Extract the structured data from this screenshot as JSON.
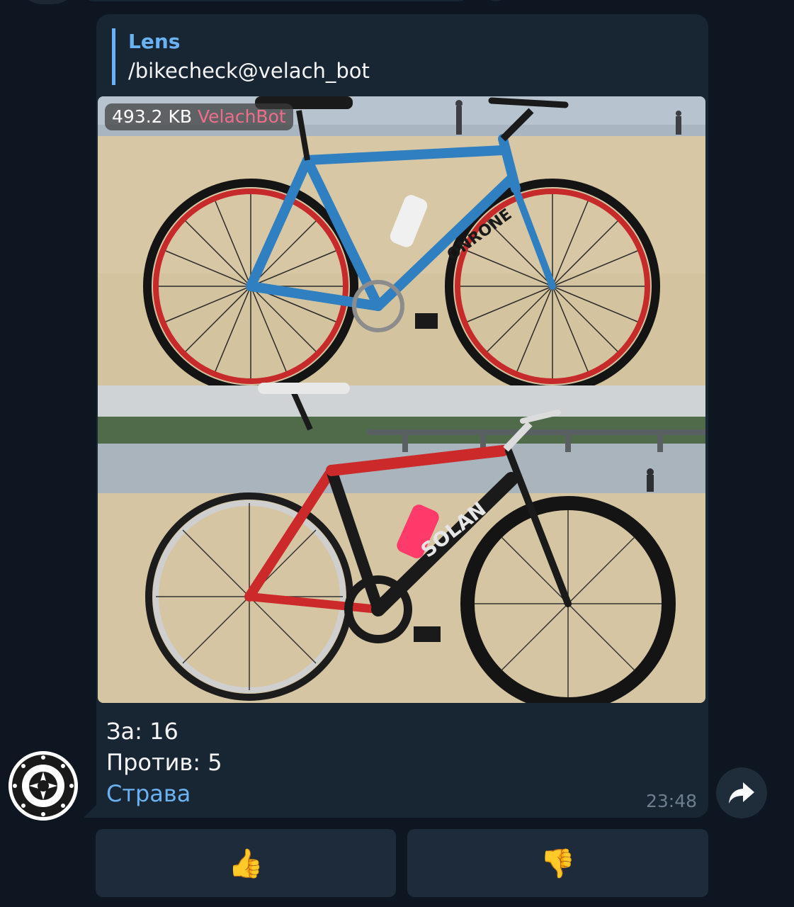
{
  "message": {
    "reply": {
      "author": "Lens",
      "text": "/bikecheck@velach_bot"
    },
    "photo": {
      "size": "493.2 KB",
      "via": "VelachBot"
    },
    "caption": {
      "for_line": "За: 16",
      "against_line": "Против: 5",
      "link": "Страва"
    },
    "time": "23:48"
  },
  "keyboard": {
    "like": "👍",
    "dislike": "👎"
  },
  "icons": {
    "forward": "forward-arrow-icon",
    "avatar": "chainring-icon"
  },
  "colors": {
    "background": "#0e1621",
    "bubble": "#182533",
    "accent": "#6ab2f2",
    "via": "#ee6e8a",
    "button": "#1d2b3a"
  }
}
